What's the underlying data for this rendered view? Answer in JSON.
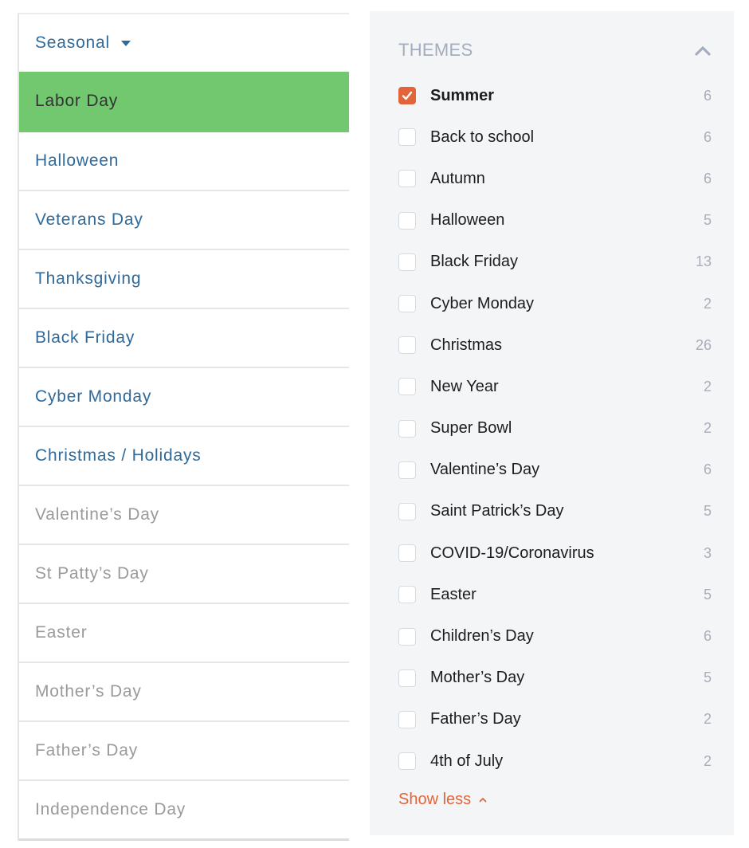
{
  "nav": {
    "header": {
      "label": "Seasonal",
      "icon": "caret-down-icon"
    },
    "items": [
      {
        "label": "Labor Day",
        "state": "active"
      },
      {
        "label": "Halloween",
        "state": "link"
      },
      {
        "label": "Veterans Day",
        "state": "link"
      },
      {
        "label": "Thanksgiving",
        "state": "link"
      },
      {
        "label": "Black Friday",
        "state": "link"
      },
      {
        "label": "Cyber Monday",
        "state": "link"
      },
      {
        "label": "Christmas / Holidays",
        "state": "link"
      },
      {
        "label": "Valentine’s Day",
        "state": "muted"
      },
      {
        "label": "St Patty’s Day",
        "state": "muted"
      },
      {
        "label": "Easter",
        "state": "muted"
      },
      {
        "label": "Mother’s Day",
        "state": "muted"
      },
      {
        "label": "Father’s Day",
        "state": "muted"
      },
      {
        "label": "Independence Day",
        "state": "muted"
      }
    ]
  },
  "themes": {
    "title": "THEMES",
    "collapse_icon": "chevron-up-icon",
    "items": [
      {
        "label": "Summer",
        "count": "6",
        "checked": true
      },
      {
        "label": "Back to school",
        "count": "6",
        "checked": false
      },
      {
        "label": "Autumn",
        "count": "6",
        "checked": false
      },
      {
        "label": "Halloween",
        "count": "5",
        "checked": false
      },
      {
        "label": "Black Friday",
        "count": "13",
        "checked": false
      },
      {
        "label": "Cyber Monday",
        "count": "2",
        "checked": false
      },
      {
        "label": "Christmas",
        "count": "26",
        "checked": false
      },
      {
        "label": "New Year",
        "count": "2",
        "checked": false
      },
      {
        "label": "Super Bowl",
        "count": "2",
        "checked": false
      },
      {
        "label": "Valentine’s Day",
        "count": "6",
        "checked": false
      },
      {
        "label": "Saint Patrick’s Day",
        "count": "5",
        "checked": false
      },
      {
        "label": "COVID-19/Coronavirus",
        "count": "3",
        "checked": false
      },
      {
        "label": "Easter",
        "count": "5",
        "checked": false
      },
      {
        "label": "Children’s Day",
        "count": "6",
        "checked": false
      },
      {
        "label": "Mother’s Day",
        "count": "5",
        "checked": false
      },
      {
        "label": "Father’s Day",
        "count": "2",
        "checked": false
      },
      {
        "label": "4th of July",
        "count": "2",
        "checked": false
      }
    ],
    "show_less_label": "Show less"
  },
  "colors": {
    "active_green": "#72c86e",
    "link_blue": "#2f6a9a",
    "accent_orange": "#e2643a",
    "muted_gray": "#9a9a9a"
  }
}
